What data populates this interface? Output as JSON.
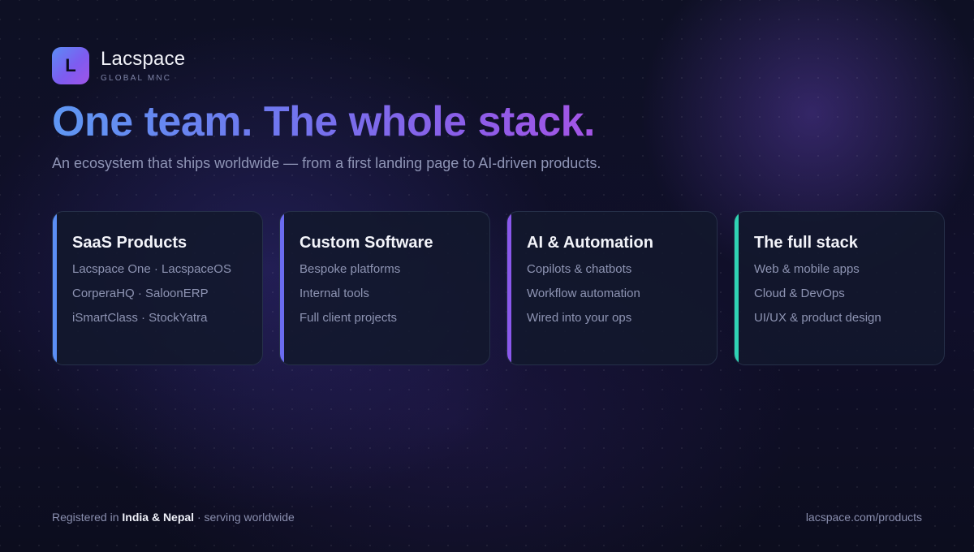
{
  "brand": {
    "logo_letter": "L",
    "name": "Lacspace",
    "tagline": "GLOBAL MNC"
  },
  "hero": {
    "headline": "One team. The whole stack.",
    "subline": "An ecosystem that ships worldwide — from a first landing page to AI-driven products."
  },
  "cards": [
    {
      "title": "SaaS Products",
      "accent": "#5b8ef5",
      "items": [
        "Lacspace One · LacspaceOS",
        "CorperaHQ · SaloonERP",
        "iSmartClass · StockYatra"
      ]
    },
    {
      "title": "Custom Software",
      "accent": "#6b6cf0",
      "items": [
        "Bespoke platforms",
        "Internal tools",
        "Full client projects"
      ]
    },
    {
      "title": "AI & Automation",
      "accent": "#8a58ec",
      "items": [
        "Copilots & chatbots",
        "Workflow automation",
        "Wired into your ops"
      ]
    },
    {
      "title": "The full stack",
      "accent": "#2fd3b4",
      "items": [
        "Web & mobile apps",
        "Cloud & DevOps",
        "UI/UX & product design"
      ]
    }
  ],
  "footer": {
    "registered_prefix": "Registered in ",
    "registered_countries": "India & Nepal",
    "registered_suffix": " · serving worldwide",
    "link": "lacspace.com/products"
  }
}
